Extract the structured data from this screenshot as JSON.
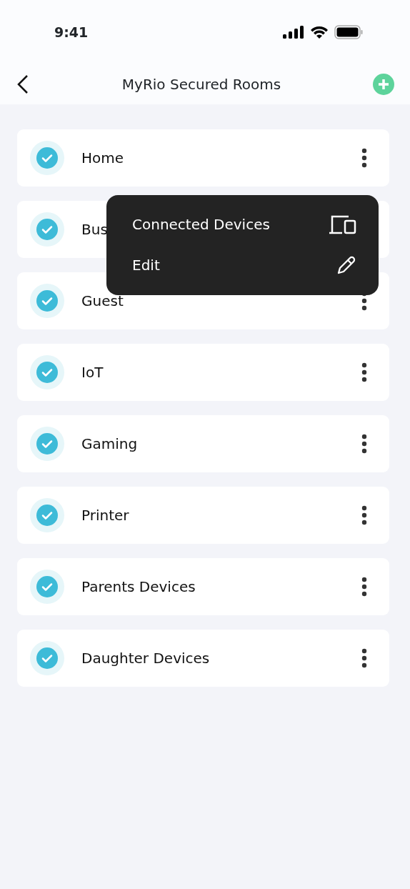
{
  "status_bar": {
    "time": "9:41"
  },
  "header": {
    "title": "MyRio Secured Rooms"
  },
  "rooms": [
    {
      "name": "Home",
      "checked": true,
      "menu_open": false
    },
    {
      "name": "Bus",
      "checked": true,
      "menu_open": true
    },
    {
      "name": "Guest",
      "checked": true,
      "menu_open": false
    },
    {
      "name": "IoT",
      "checked": true,
      "menu_open": false
    },
    {
      "name": "Gaming",
      "checked": true,
      "menu_open": false
    },
    {
      "name": "Printer",
      "checked": true,
      "menu_open": false
    },
    {
      "name": "Parents Devices",
      "checked": true,
      "menu_open": false
    },
    {
      "name": "Daughter Devices",
      "checked": true,
      "menu_open": false
    }
  ],
  "popup_menu": [
    {
      "label": "Connected Devices",
      "kind": "devices"
    },
    {
      "label": "Edit",
      "kind": "edit"
    }
  ]
}
